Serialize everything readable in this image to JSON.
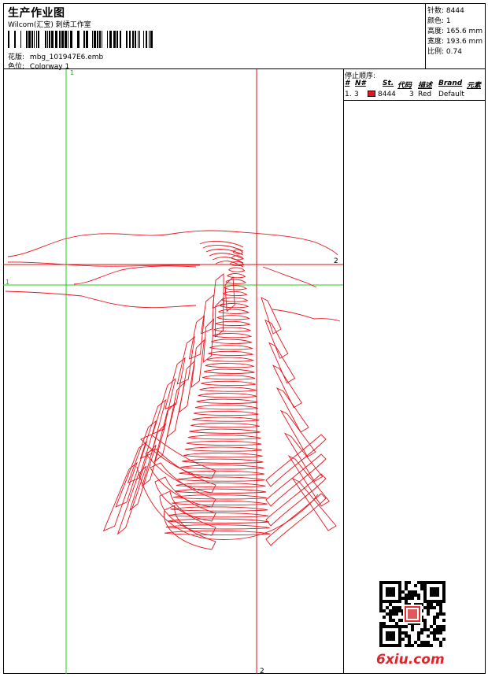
{
  "header": {
    "title": "生产作业图",
    "subtitle": "Wilcom(汇宝) 刺绣工作室",
    "design_label": "花版:",
    "design_file": "mbg_101947E6.emb",
    "colorway_label": "色位:",
    "colorway": "Colorway 1"
  },
  "stats": {
    "stitches_label": "针数:",
    "stitches": "8444",
    "colors_label": "颜色:",
    "colors": "1",
    "height_label": "高度:",
    "height": "165.6 mm",
    "width_label": "宽度:",
    "width": "193.6 mm",
    "scale_label": "比例:",
    "scale": "0.74"
  },
  "guides": {
    "green_top": "1",
    "green_left": "1",
    "red_right": "2",
    "red_bottom": "2"
  },
  "stop_sequence": {
    "heading": "停止顺序:",
    "columns": {
      "hash": "#",
      "no": "N#",
      "st": "St.",
      "code": "代码",
      "desc": "描述",
      "brand": "Brand",
      "element": "元素"
    },
    "rows": [
      {
        "index": "1.",
        "no": "3",
        "stitches": "8444",
        "code": "3",
        "desc": "Red",
        "brand": "Default",
        "color": "#e8141e"
      }
    ]
  },
  "watermark": {
    "text": "6xiu.com"
  },
  "colors": {
    "thread": "#e8141e",
    "guide_green": "#22cc22",
    "guide_red": "#dd1111"
  }
}
